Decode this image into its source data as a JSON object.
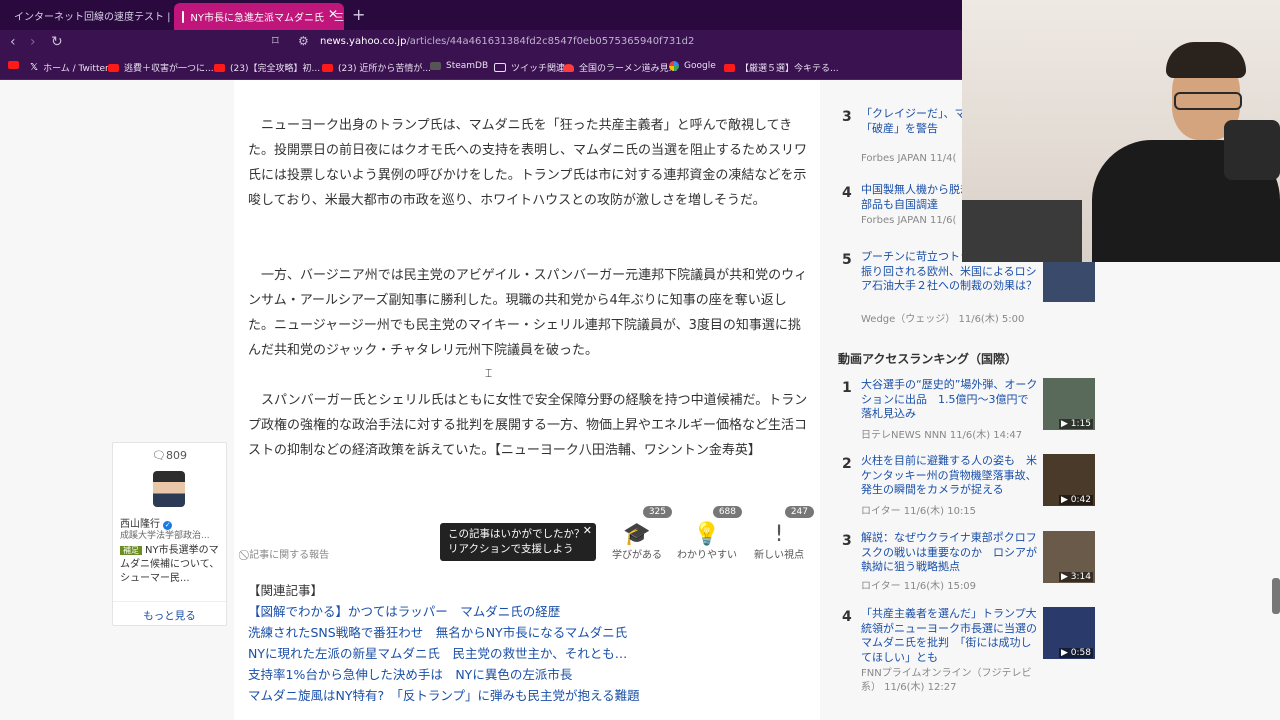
{
  "browser": {
    "tabs": [
      {
        "label": "インターネット回線の速度テスト | Fast.com"
      },
      {
        "label": "NY市長に急進左派マムダニ氏　三"
      }
    ],
    "url_host": "news.yahoo.co.jp",
    "url_path": "/articles/44a461631384fd2c8547f0eb0575365940f731d2",
    "bookmarks": [
      {
        "label": ""
      },
      {
        "label": "ホーム / Twitter"
      },
      {
        "label": "逃費＋収害が一つに..."
      },
      {
        "label": "(23)【完全攻略】初..."
      },
      {
        "label": "(23) 近所から苦情が..."
      },
      {
        "label": "SteamDB"
      },
      {
        "label": "ツイッチ関連"
      },
      {
        "label": "全国のラーメン道み見..."
      },
      {
        "label": "Google"
      },
      {
        "label": "【厳選５選】今キテる..."
      }
    ]
  },
  "article": {
    "paragraphs": [
      "　ニューヨーク出身のトランプ氏は、マムダニ氏を「狂った共産主義者」と呼んで敵視してきた。投開票日の前日夜にはクオモ氏への支持を表明し、マムダニ氏の当選を阻止するためスリワ氏には投票しないよう異例の呼びかけをした。トランプ氏は市に対する連邦資金の凍結などを示唆しており、米最大都市の市政を巡り、ホワイトハウスとの攻防が激しさを増しそうだ。",
      "　一方、バージニア州では民主党のアビゲイル・スパンバーガー元連邦下院議員が共和党のウィンサム・アールシアーズ副知事に勝利した。現職の共和党から4年ぶりに知事の座を奪い返した。ニュージャージー州でも民主党のマイキー・シェリル連邦下院議員が、3度目の知事選に挑んだ共和党のジャック・チャタレリ元州下院議員を破った。",
      "　スパンバーガー氏とシェリル氏はともに女性で安全保障分野の経験を持つ中道候補だ。トランプ政権の強権的な政治手法に対する批判を展開する一方、物価上昇やエネルギー価格など生活コストの抑制などの経済政策を訴えていた。【ニューヨーク八田浩輔、ワシントン金寿英】"
    ],
    "report_label": "⃠ 記事に関する報告",
    "tooltip": "この記事はいかがでしたか？リアクションで支援しよう",
    "reactions": [
      {
        "label": "学びがある",
        "count": "325",
        "icon": "mortarboard-icon",
        "glyph": "🎓"
      },
      {
        "label": "わかりやすい",
        "count": "688",
        "icon": "lightbulb-icon",
        "glyph": "💡"
      },
      {
        "label": "新しい視点",
        "count": "247",
        "icon": "exclamation-icon",
        "glyph": "!"
      }
    ],
    "related_heading": "【関連記事】",
    "related_links": [
      "【図解でわかる】かつてはラッパー　マムダニ氏の経歴",
      "洗練されたSNS戦略で番狂わせ　無名からNY市長になるマムダニ氏",
      "NYに現れた左派の新星マムダニ氏　民主党の救世主か、それとも…",
      "支持率1%台から急伸した決め手は　NYに異色の左派市長",
      "マムダニ旋風はNY特有?　「反トランプ」に弾みも民主党が抱える難題"
    ]
  },
  "comment_panel": {
    "count": "809",
    "name": "西山隆行",
    "role": "成蹊大学法学部政治...",
    "tag": "補足",
    "text": "NY市長選挙のマムダニ候補について、シューマー民...",
    "more_label": "もっと見る"
  },
  "ranking_top": [
    {
      "rank": "3",
      "title": "「クレイジーだ」、マスクが米国の「破産」を警告",
      "meta": "Forbes JAPAN 11/4("
    },
    {
      "rank": "4",
      "title": "中国製無人機から脱却、ウクライナ　部品も自国調達",
      "meta": "Forbes JAPAN 11/6("
    },
    {
      "rank": "5",
      "title": "プーチンに苛立つトランプ、怒り！振り回される欧州、米国によるロシア石油大手２社への制裁の効果は？",
      "meta": "Wedge（ウェッジ） 11/6(木) 5:00"
    }
  ],
  "video_ranking": {
    "heading": "動画アクセスランキング（国際）",
    "items": [
      {
        "rank": "1",
        "title": "大谷選手の“歴史的”場外弾、オークションに出品　1.5億円～3億円で落札見込み",
        "meta": "日テレNEWS NNN 11/6(木) 14:47",
        "duration": "▶ 1:15"
      },
      {
        "rank": "2",
        "title": "火柱を目前に避難する人の姿も　米ケンタッキー州の貨物機墜落事故、発生の瞬間をカメラが捉える",
        "meta": "ロイター 11/6(木) 10:15",
        "duration": "▶ 0:42"
      },
      {
        "rank": "3",
        "title": "解説：なぜウクライナ東部ポクロフスクの戦いは重要なのか　ロシアが執拗に狙う戦略拠点",
        "meta": "ロイター 11/6(木) 15:09",
        "duration": "▶ 3:14"
      },
      {
        "rank": "4",
        "title": "「共産主義者を選んだ」トランプ大統領がニューヨーク市長選に当選のマムダニ氏を批判　「街には成功してほしい」とも",
        "meta": "FNNプライムオンライン（フジテレビ系） 11/6(木) 12:27",
        "duration": "▶ 0:58"
      }
    ]
  },
  "colors": {
    "tab_bg": "#2a0a3e",
    "active_tab": "#c0157a",
    "link": "#1a4fa8"
  }
}
